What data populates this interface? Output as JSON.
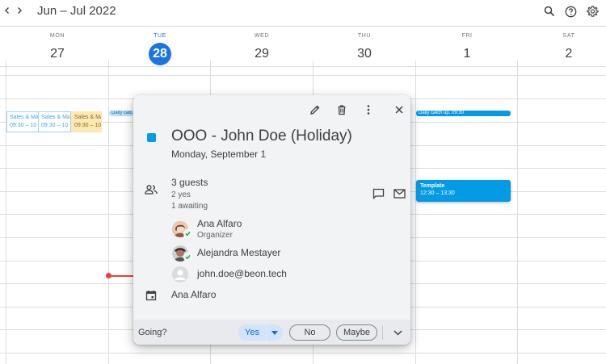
{
  "header": {
    "period": "Jun – Jul 2022",
    "prev_icon": "chevron-left-icon",
    "next_icon": "chevron-right-icon",
    "search_icon": "search-icon",
    "help_icon": "help-icon",
    "settings_icon": "gear-icon"
  },
  "days": [
    {
      "name": "MON",
      "num": "27"
    },
    {
      "name": "TUE",
      "num": "28"
    },
    {
      "name": "WED",
      "num": "29"
    },
    {
      "name": "THU",
      "num": "30"
    },
    {
      "name": "FRI",
      "num": "1"
    },
    {
      "name": "SAT",
      "num": "2"
    }
  ],
  "background_events": {
    "sales1": {
      "title": "Sales & Ma",
      "time": "09:30 – 10"
    },
    "sales2": {
      "title": "Sales & Ma",
      "time": "09:30 – 10"
    },
    "sales3": {
      "title": "Sales & Ma",
      "time": "09:30 – 10"
    },
    "daily_tue": "Daily catc",
    "daily_fri": "Daily catch up, 09:30",
    "template": {
      "title": "Template",
      "time": "12:30 – 13:30"
    }
  },
  "colors": {
    "accent": "#1a73e8",
    "event_blue": "#039be5",
    "now_red": "#ea4335"
  },
  "popup": {
    "title": "OOO - John Doe (Holiday)",
    "date": "Monday, September 1",
    "guests_count": "3 guests",
    "guests_yes": "2 yes",
    "guests_awaiting": "1 awaiting",
    "guests": [
      {
        "name": "Ana Alfaro",
        "role": "Organizer"
      },
      {
        "name": "Alejandra Mestayer",
        "role": ""
      },
      {
        "name": "john.doe@beon.tech",
        "role": ""
      }
    ],
    "calendar_owner": "Ana Alfaro",
    "going_label": "Going?",
    "yes_label": "Yes",
    "no_label": "No",
    "maybe_label": "Maybe"
  }
}
